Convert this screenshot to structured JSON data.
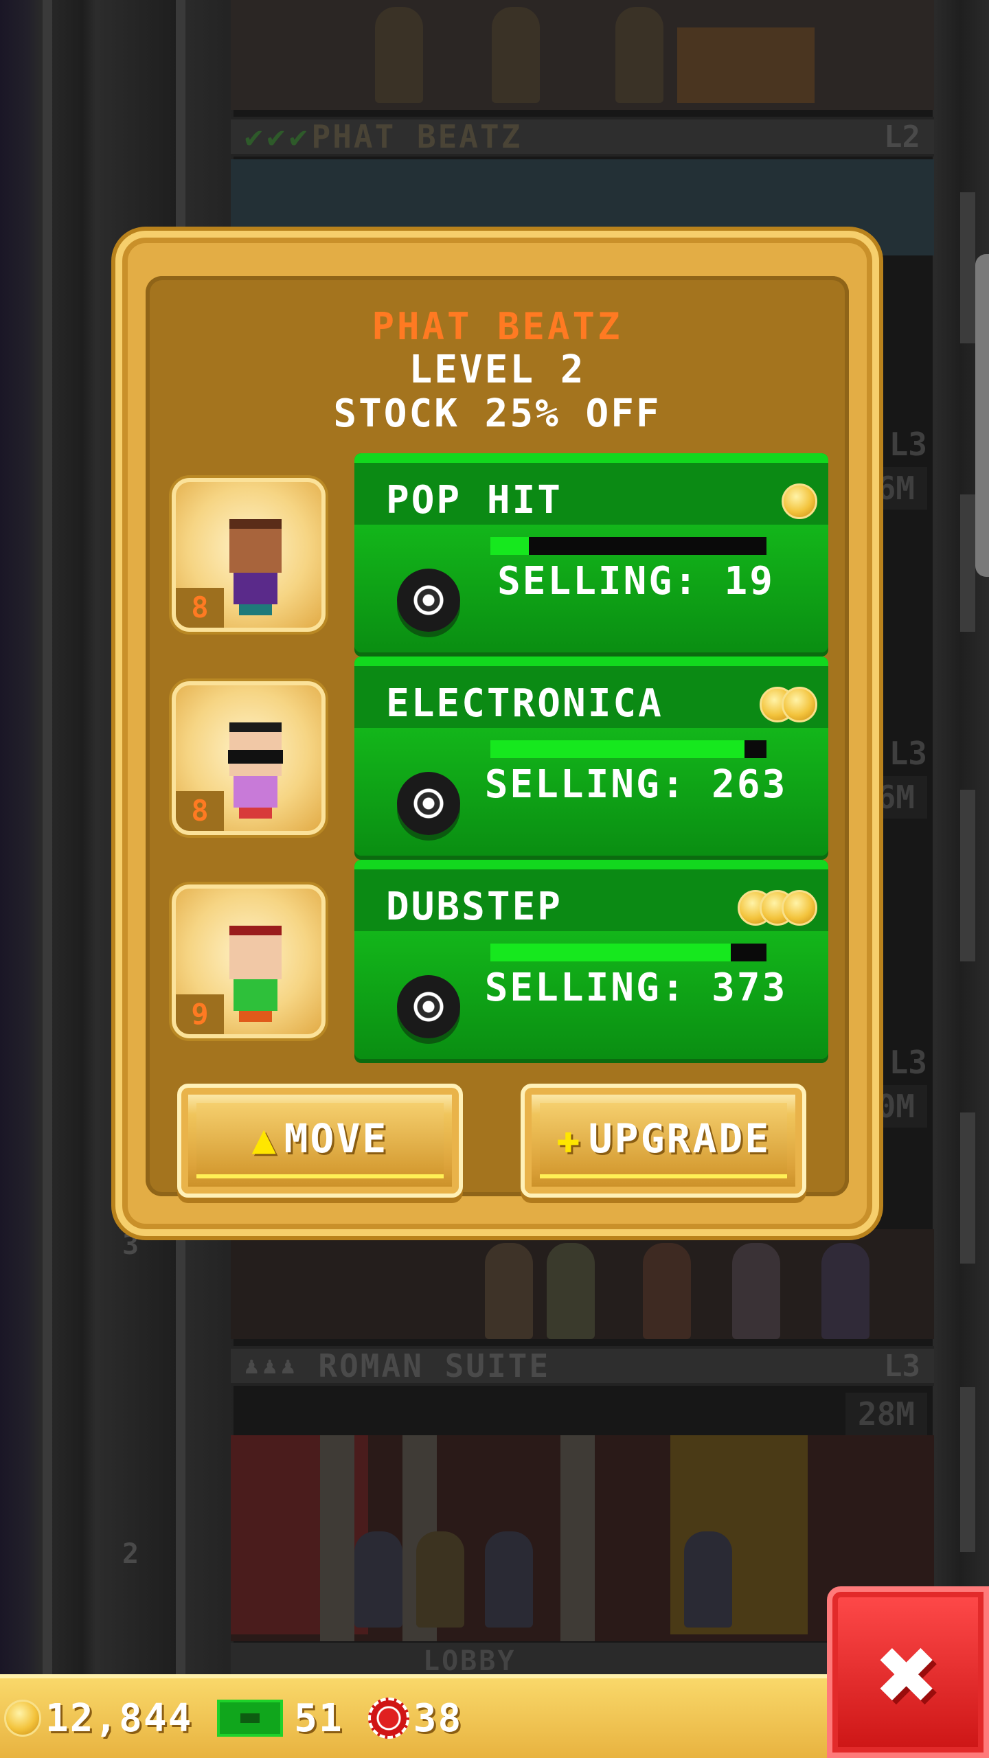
{
  "background": {
    "floors": [
      {
        "name": "PHAT BEATZ",
        "level": "L2",
        "checks": 3
      },
      {
        "name": "ROMAN SUITE",
        "level": "L3",
        "price": "28M"
      },
      {
        "name": "LOBBY"
      }
    ],
    "side_tags": [
      {
        "level": "L3",
        "price": "6M"
      },
      {
        "level": "L3",
        "price": "6M"
      },
      {
        "level": "L3",
        "price": "30M"
      }
    ],
    "floor_numbers": [
      "3",
      "2"
    ]
  },
  "dialog": {
    "title": "PHAT BEATZ",
    "level_text": "LEVEL 2",
    "stock_text": "STOCK 25% OFF",
    "products": [
      {
        "name": "POP HIT",
        "coins": 1,
        "selling": "SELLING: 19",
        "progress": 0.14,
        "resident_badge": "8",
        "resident": "resident-brown"
      },
      {
        "name": "ELECTRONICA",
        "coins": 2,
        "selling": "SELLING: 263",
        "progress": 0.92,
        "resident_badge": "8",
        "resident": "resident-glasses"
      },
      {
        "name": "DUBSTEP",
        "coins": 3,
        "selling": "SELLING: 373",
        "progress": 0.87,
        "resident_badge": "9",
        "resident": "resident-redhair"
      }
    ],
    "move_button": {
      "label": "MOVE",
      "icon": "arrow-up-icon"
    },
    "upgrade_button": {
      "label": "UPGRADE",
      "icon": "plus-icon"
    }
  },
  "status_bar": {
    "coins": "12,844",
    "bux": "51",
    "chips": "38"
  },
  "close_button": {
    "icon": "close-icon"
  },
  "colors": {
    "accent_orange": "#ff7a22",
    "panel_gold": "#e3ad45",
    "product_green": "#0a9a12",
    "close_red": "#e02020"
  }
}
